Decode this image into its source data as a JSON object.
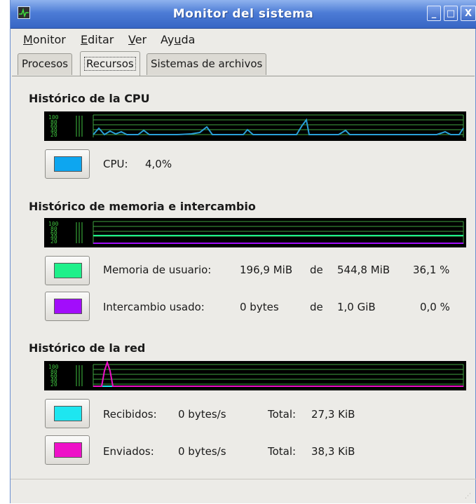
{
  "window": {
    "title": "Monitor del sistema",
    "minimize": "_",
    "maximize": "□",
    "close": "X"
  },
  "menu": {
    "items": [
      {
        "label": "Monitor",
        "u": "M",
        "rest": "onitor"
      },
      {
        "label": "Editar",
        "u": "E",
        "rest": "ditar"
      },
      {
        "label": "Ver",
        "u": "V",
        "rest": "er"
      },
      {
        "label": "Ayuda",
        "pre": "Ay",
        "u": "u",
        "rest": "da"
      }
    ]
  },
  "tabs": [
    {
      "label": "Procesos"
    },
    {
      "label": "Recursos"
    },
    {
      "label": "Sistemas de archivos"
    }
  ],
  "active_tab": "Recursos",
  "cpu": {
    "title": "Histórico de la CPU",
    "graph_labels": [
      "100",
      "80",
      "60",
      "40",
      "20"
    ],
    "legend": {
      "label": "CPU:",
      "value": "4,0%",
      "color": "#0da6f0"
    },
    "trace_color": "#2aa0d8"
  },
  "memory": {
    "title": "Histórico de memoria e intercambio",
    "graph_labels": [
      "100",
      "80",
      "60",
      "40",
      "20"
    ],
    "user": {
      "label": "Memoria de usuario:",
      "used": "196,9 MiB",
      "of": "de",
      "total": "544,8 MiB",
      "percent": "36,1 %",
      "color": "#1ef08a"
    },
    "swap": {
      "label": "Intercambio usado:",
      "used": "0 bytes",
      "of": "de",
      "total": "1,0 GiB",
      "percent": "0,0 %",
      "color": "#a20dfb"
    }
  },
  "network": {
    "title": "Histórico de la red",
    "graph_labels": [
      "100",
      "80",
      "60",
      "40",
      "20"
    ],
    "received": {
      "label": "Recibidos:",
      "rate": "0 bytes/s",
      "total_label": "Total:",
      "total": "27,3 KiB",
      "color": "#1ee6f0"
    },
    "sent": {
      "label": "Enviados:",
      "rate": "0 bytes/s",
      "total_label": "Total:",
      "total": "38,3 KiB",
      "color": "#ee10c8"
    }
  },
  "colors": {
    "titlebar": "#4d7cd6",
    "graph_bg": "#000000",
    "grid": "#3fa53f"
  }
}
